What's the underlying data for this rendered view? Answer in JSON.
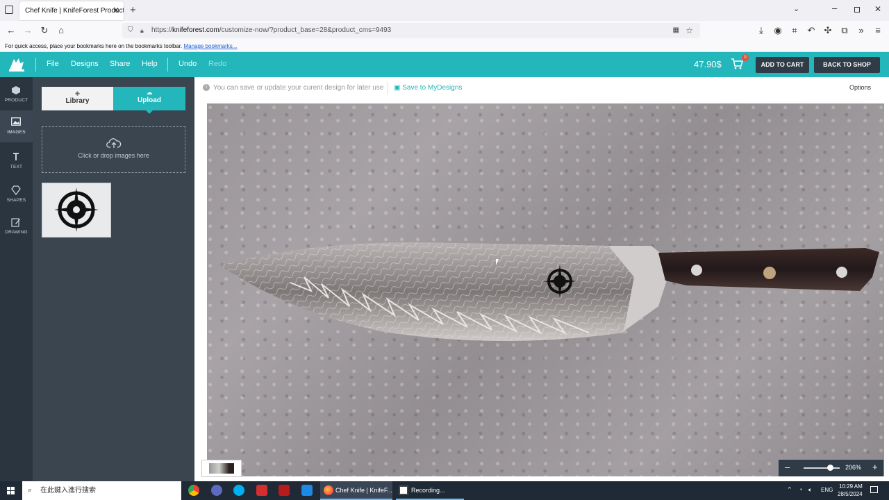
{
  "browser": {
    "tab_title": "Chef Knife | KnifeForest Products D",
    "url_prefix": "https://",
    "url_host": "knifeforest.com",
    "url_path": "/customize-now/?product_base=28&product_cms=9493",
    "bookmarks_hint": "For quick access, place your bookmarks here on the bookmarks toolbar.",
    "bookmarks_link": "Manage bookmarks..."
  },
  "header": {
    "menu": [
      "File",
      "Designs",
      "Share",
      "Help",
      "Undo",
      "Redo"
    ],
    "price": "47.90$",
    "cart_count": "0",
    "add_to_cart": "ADD TO CART",
    "back_to_shop": "BACK TO SHOP"
  },
  "rail": {
    "items": [
      {
        "label": "PRODUCT",
        "icon": "cube-icon"
      },
      {
        "label": "IMAGES",
        "icon": "image-icon"
      },
      {
        "label": "TEXT",
        "icon": "text-icon"
      },
      {
        "label": "SHAPES",
        "icon": "diamond-icon"
      },
      {
        "label": "DRAWING",
        "icon": "pencil-icon"
      }
    ]
  },
  "panel": {
    "tab_library": "Library",
    "tab_upload": "Upload",
    "dropzone_text": "Click or drop images here"
  },
  "workarea": {
    "info_text": "You can save or update your curent design for later use",
    "save_link": "Save to MyDesigns",
    "options": "Options",
    "zoom": "206%"
  },
  "taskbar": {
    "search_placeholder": "在此鍵入進行搜索",
    "firefox_app": "Chef Knife | KnifeF...",
    "recording_app": "Recording...",
    "lang": "ENG",
    "time": "10:29 AM",
    "date": "28/5/2024"
  },
  "colors": {
    "accent": "#23b6ba",
    "dark": "#2f3b46",
    "panel": "#3a4550",
    "rail": "#2b3540"
  }
}
